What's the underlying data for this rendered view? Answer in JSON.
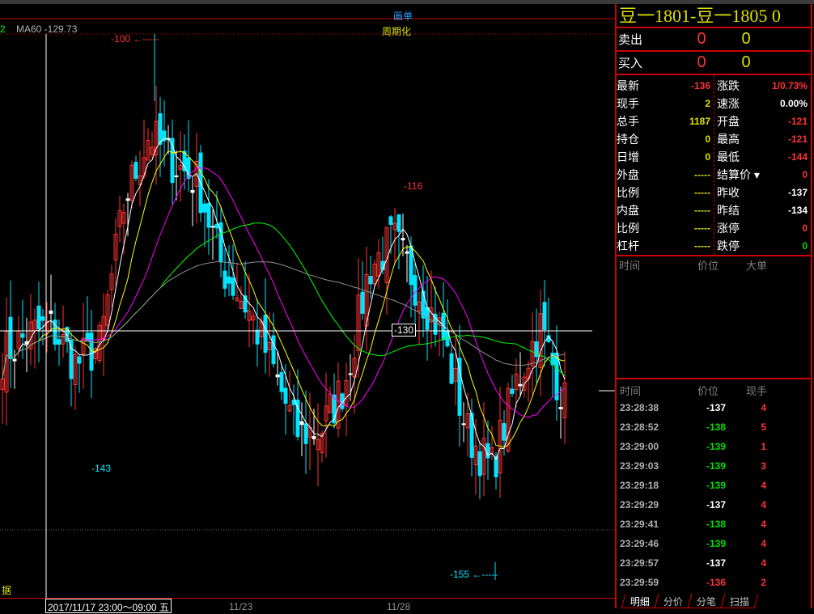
{
  "chart": {
    "ma_indicator": "MA60 -129.73",
    "tool_label": "画单",
    "period_label": "周期化",
    "crosshair_price": "-130",
    "side_label": "据",
    "cursor_time": "2017/11/17 23:00～09:00 五",
    "x_labels": [
      "11/23",
      "11/28"
    ],
    "high_mark": "-100",
    "low_mark": "-155",
    "annotations": [
      "-143",
      "-116"
    ]
  },
  "chart_data": {
    "type": "candlestick",
    "ylim": [
      -160,
      -99
    ],
    "price_path": [
      -133,
      -131,
      -130,
      -134,
      -132,
      -117,
      -110,
      -113,
      -115,
      -124,
      -128,
      -134,
      -141,
      -141,
      -136,
      -124,
      -121,
      -126,
      -131,
      -141,
      -145,
      -136,
      -130,
      -138
    ],
    "colors": {
      "up": "#ff3333",
      "down": "#00e5ff",
      "ma5": "#ffffff",
      "ma10": "#ffff00",
      "ma20": "#ff00ff",
      "ma40": "#00ff00",
      "ma60": "#909090"
    }
  },
  "panel": {
    "title": "豆一1801-豆一1805  0",
    "sell": {
      "label": "卖出",
      "price": "0",
      "qty": "0"
    },
    "buy": {
      "label": "买入",
      "price": "0",
      "qty": "0"
    },
    "left": [
      {
        "k": "最新",
        "v": "-136",
        "c": "#ff3333"
      },
      {
        "k": "现手",
        "v": "2",
        "c": "#e0e000"
      },
      {
        "k": "总手",
        "v": "1187",
        "c": "#e0e000"
      },
      {
        "k": "持仓",
        "v": "0",
        "c": "#e0e000"
      },
      {
        "k": "日增",
        "v": "0",
        "c": "#e0e000"
      },
      {
        "k": "外盘",
        "v": "-----",
        "c": "#e0e000"
      },
      {
        "k": "比例",
        "v": "-----",
        "c": "#e0e000"
      },
      {
        "k": "内盘",
        "v": "-----",
        "c": "#e0e000"
      },
      {
        "k": "比例",
        "v": "-----",
        "c": "#e0e000"
      },
      {
        "k": "杠杆",
        "v": "-----",
        "c": "#e0e000"
      }
    ],
    "right": [
      {
        "k": "涨跌",
        "v": "1/0.73%",
        "c": "#ff3333"
      },
      {
        "k": "速涨",
        "v": "0.00%",
        "c": "#ffffff"
      },
      {
        "k": "开盘",
        "v": "-121",
        "c": "#ff3333"
      },
      {
        "k": "最高",
        "v": "-121",
        "c": "#ff3333"
      },
      {
        "k": "最低",
        "v": "-144",
        "c": "#ff3333"
      },
      {
        "k": "结算价 ▾",
        "v": "0",
        "c": "#ff3333"
      },
      {
        "k": "昨收",
        "v": "-137",
        "c": "#ffffff"
      },
      {
        "k": "昨结",
        "v": "-134",
        "c": "#ffffff"
      },
      {
        "k": "涨停",
        "v": "0",
        "c": "#ff3333"
      },
      {
        "k": "跌停",
        "v": "0",
        "c": "#00dd00"
      }
    ],
    "big_header": [
      "时间",
      "价位",
      "大单"
    ],
    "tick_header": [
      "时间",
      "价位",
      "现手"
    ],
    "ticks": [
      {
        "t": "23:28:38",
        "p": "-137",
        "q": "4",
        "pc": "#ffffff"
      },
      {
        "t": "23:28:52",
        "p": "-138",
        "q": "5",
        "pc": "#00dd00"
      },
      {
        "t": "23:29:00",
        "p": "-139",
        "q": "1",
        "pc": "#00dd00"
      },
      {
        "t": "23:29:03",
        "p": "-139",
        "q": "3",
        "pc": "#00dd00"
      },
      {
        "t": "23:29:18",
        "p": "-139",
        "q": "4",
        "pc": "#00dd00"
      },
      {
        "t": "23:29:29",
        "p": "-137",
        "q": "4",
        "pc": "#ffffff"
      },
      {
        "t": "23:29:41",
        "p": "-138",
        "q": "4",
        "pc": "#00dd00"
      },
      {
        "t": "23:29:46",
        "p": "-139",
        "q": "4",
        "pc": "#00dd00"
      },
      {
        "t": "23:29:57",
        "p": "-137",
        "q": "4",
        "pc": "#ffffff"
      },
      {
        "t": "23:29:59",
        "p": "-136",
        "q": "2",
        "pc": "#ff3333"
      }
    ],
    "tabs": [
      "明细",
      "分价",
      "分笔",
      "扫描"
    ]
  }
}
